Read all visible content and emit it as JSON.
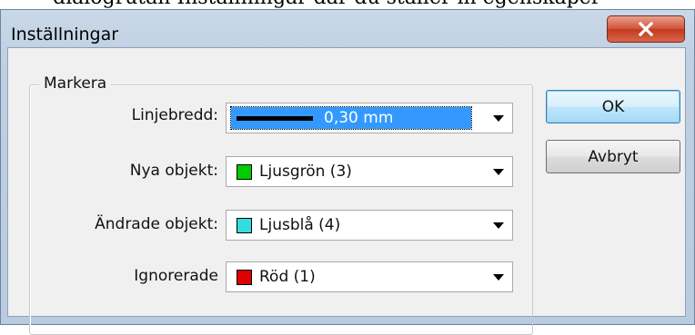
{
  "background_text": "dialogrutan Inställningar där du ställer in egenskaper",
  "window": {
    "title": "Inställningar",
    "close_symbol": "X"
  },
  "group": {
    "legend": "Markera"
  },
  "rows": [
    {
      "label": "Linjebredd:",
      "value": "0,30 mm",
      "kind": "line",
      "selected": true
    },
    {
      "label": "Nya objekt:",
      "value": "Ljusgrön (3)",
      "kind": "color",
      "color": "#00cc00"
    },
    {
      "label": "Ändrade objekt:",
      "value": "Ljusblå (4)",
      "kind": "color",
      "color": "#33dddd"
    },
    {
      "label": "Ignorerade",
      "value": "Röd (1)",
      "kind": "color",
      "color": "#dd0000"
    }
  ],
  "buttons": {
    "ok": "OK",
    "cancel": "Avbryt"
  },
  "colors": {
    "selection": "#3399ff",
    "title_bar": "#bfd0e3",
    "close_button": "#c23a1f"
  }
}
